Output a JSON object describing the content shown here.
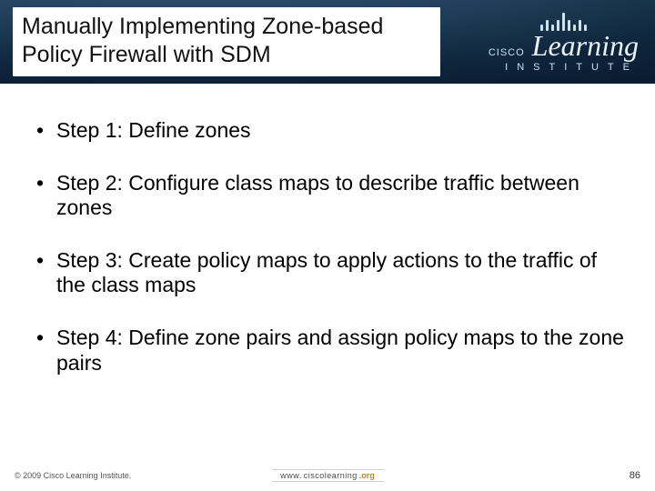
{
  "header": {
    "title": "Manually Implementing Zone-based Policy Firewall with SDM",
    "logo": {
      "brand_small": "CISCO",
      "brand_big": "Learning",
      "brand_sub": "INSTITUTE"
    }
  },
  "bullets": [
    "Step 1: Define zones",
    "Step 2: Configure class maps to describe traffic between zones",
    "Step 3: Create policy maps to apply actions to the traffic of the class maps",
    "Step 4: Define zone pairs and assign policy maps to the zone pairs"
  ],
  "footer": {
    "copyright": "© 2009 Cisco Learning Institute.",
    "url_prefix": "www.",
    "url_mid": "ciscolearning",
    "url_suffix": ".org",
    "page_number": "86"
  }
}
